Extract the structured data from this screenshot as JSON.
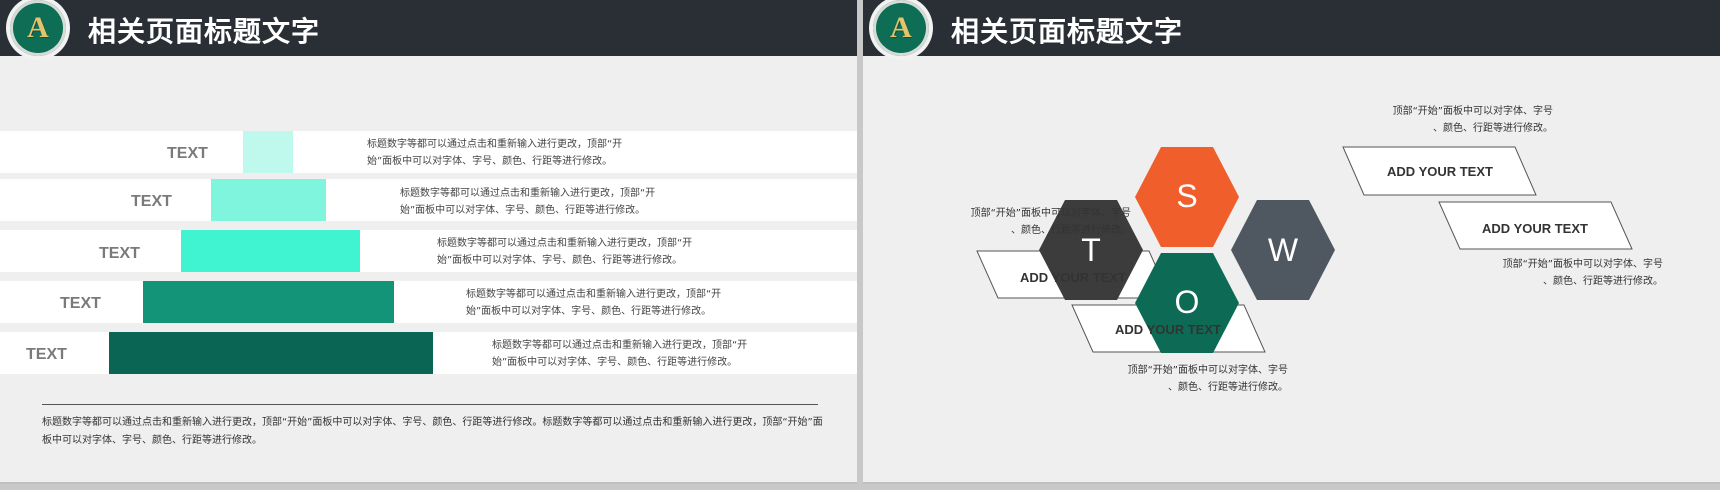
{
  "left_slide": {
    "title": "相关页面标题文字",
    "logo_letter": "A",
    "bars": [
      {
        "label": "TEXT",
        "color": "#bff9ee",
        "desc": [
          "标题数字等都可以通过点击和重新输入进行更改，顶部“开",
          "始”面板中可以对字体、字号、颜色、行距等进行修改。"
        ]
      },
      {
        "label": "TEXT",
        "color": "#7ff5dd",
        "desc": [
          "标题数字等都可以通过点击和重新输入进行更改，顶部“开",
          "始”面板中可以对字体、字号、颜色、行距等进行修改。"
        ]
      },
      {
        "label": "TEXT",
        "color": "#40f4d2",
        "desc": [
          "标题数字等都可以通过点击和重新输入进行更改，顶部“开",
          "始”面板中可以对字体、字号、颜色、行距等进行修改。"
        ]
      },
      {
        "label": "TEXT",
        "color": "#139478",
        "desc": [
          "标题数字等都可以通过点击和重新输入进行更改，顶部“开",
          "始”面板中可以对字体、字号、颜色、行距等进行修改。"
        ]
      },
      {
        "label": "TEXT",
        "color": "#0a6554",
        "desc": [
          "标题数字等都可以通过点击和重新输入进行更改，顶部“开",
          "始”面板中可以对字体、字号、颜色、行距等进行修改。"
        ]
      }
    ],
    "bottom_text": "标题数字等都可以通过点击和重新输入进行更改，顶部“开始”面板中可以对字体、字号、颜色、行距等进行修改。标题数字等都可以通过点击和重新输入进行更改，顶部“开始”面板中可以对字体、字号、颜色、行距等进行修改。"
  },
  "right_slide": {
    "title": "相关页面标题文字",
    "logo_letter": "A",
    "swot": {
      "letters": {
        "s": "S",
        "w": "W",
        "o": "O",
        "t": "T"
      },
      "colors": {
        "s": "#ef5e2b",
        "w": "#4f5860",
        "o": "#0d6b55",
        "t": "#3c3c3c"
      },
      "banners": {
        "s": "ADD YOUR TEXT",
        "w": "ADD YOUR TEXT",
        "o": "ADD YOUR TEXT",
        "t": "ADD YOUR TEXT"
      },
      "descs": {
        "s": [
          "顶部“开始”面板中可以对字体、字号",
          "、颜色、行距等进行修改。"
        ],
        "w": [
          "顶部“开始”面板中可以对字体、字号",
          "、颜色、行距等进行修改。"
        ],
        "o": [
          "顶部“开始”面板中可以对字体、字号",
          "、颜色、行距等进行修改。"
        ],
        "t": [
          "顶部“开始”面板中可以对字体、字号",
          "、颜色、行距等进行修改。"
        ]
      }
    }
  }
}
